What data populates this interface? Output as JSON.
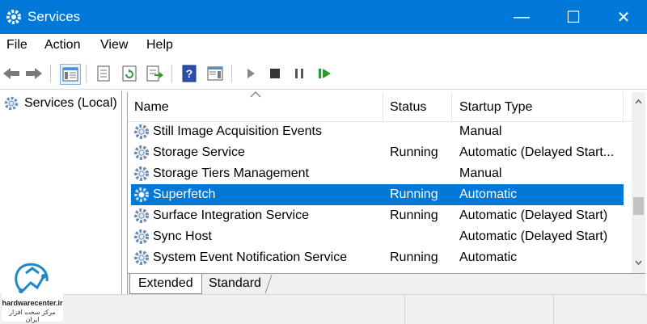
{
  "window": {
    "title": "Services",
    "minimize": "—",
    "maximize": "☐",
    "close": "✕"
  },
  "menu": [
    "File",
    "Action",
    "View",
    "Help"
  ],
  "left_pane": {
    "tree_item": "Services (Local)"
  },
  "columns": {
    "name": "Name",
    "status": "Status",
    "startup": "Startup Type"
  },
  "rows": [
    {
      "name": "Still Image Acquisition Events",
      "status": "",
      "startup": "Manual"
    },
    {
      "name": "Storage Service",
      "status": "Running",
      "startup": "Automatic (Delayed Start..."
    },
    {
      "name": "Storage Tiers Management",
      "status": "",
      "startup": "Manual"
    },
    {
      "name": "Superfetch",
      "status": "Running",
      "startup": "Automatic"
    },
    {
      "name": "Surface Integration Service",
      "status": "Running",
      "startup": "Automatic (Delayed Start)"
    },
    {
      "name": "Sync Host",
      "status": "",
      "startup": "Automatic (Delayed Start)"
    },
    {
      "name": "System Event Notification Service",
      "status": "Running",
      "startup": "Automatic"
    }
  ],
  "selected_row": 3,
  "tabs": {
    "extended": "Extended",
    "standard": "Standard"
  },
  "watermark": {
    "line1": "hardwarecenter.ir",
    "line2": "مرکز سخت افزار ایران"
  },
  "colors": {
    "titlebar": "#0078d7",
    "selection": "#0078d7",
    "logo": "#1e88c9"
  }
}
